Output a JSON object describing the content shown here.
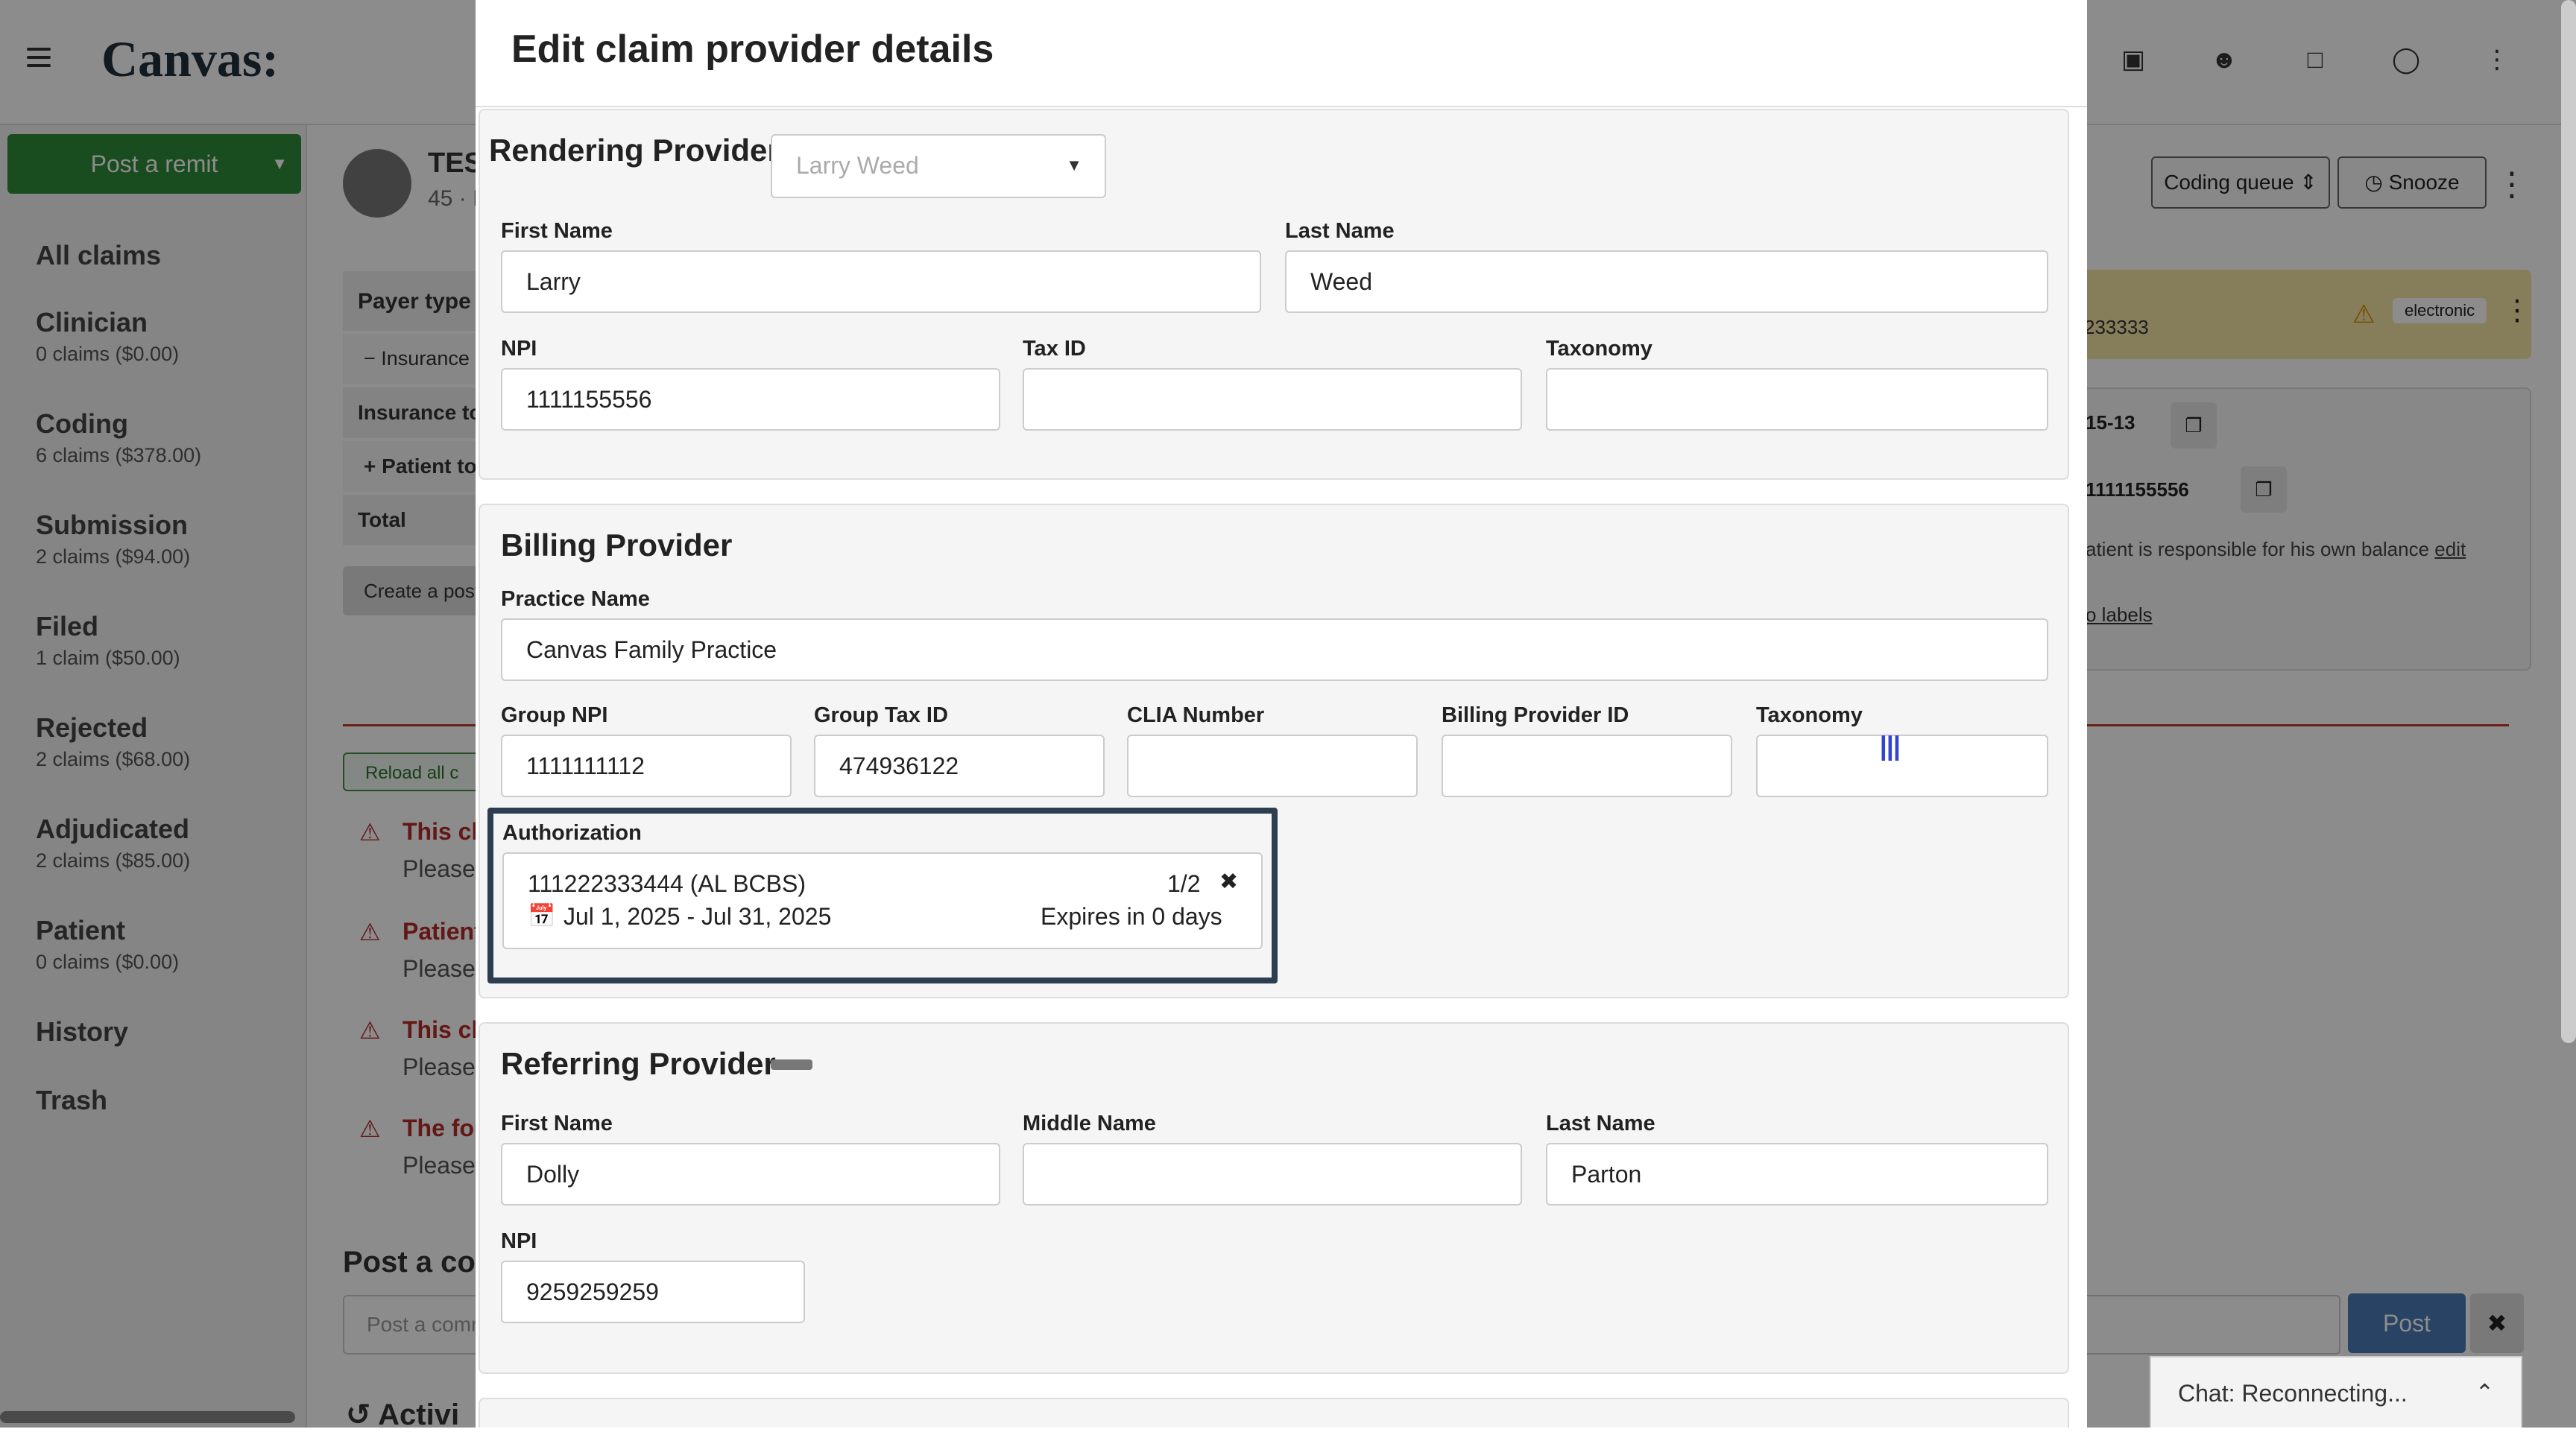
{
  "app": {
    "logo": "Canvas:"
  },
  "sidebar": {
    "post_remit": "Post a remit",
    "items": [
      {
        "label": "All claims",
        "sub": ""
      },
      {
        "label": "Clinician",
        "sub": "0 claims ($0.00)"
      },
      {
        "label": "Coding",
        "sub": "6 claims ($378.00)"
      },
      {
        "label": "Submission",
        "sub": "2 claims ($94.00)"
      },
      {
        "label": "Filed",
        "sub": "1 claim ($50.00)"
      },
      {
        "label": "Rejected",
        "sub": "2 claims ($68.00)"
      },
      {
        "label": "Adjudicated",
        "sub": "2 claims ($85.00)"
      },
      {
        "label": "Patient",
        "sub": "0 claims ($0.00)"
      },
      {
        "label": "History",
        "sub": ""
      },
      {
        "label": "Trash",
        "sub": ""
      }
    ]
  },
  "background": {
    "patient_name": "TES",
    "patient_sub": "45 · I",
    "payer_type": "Payer type",
    "insurance": "Insurance",
    "insurance_to": "Insurance to",
    "patient_to": "Patient to",
    "total": "Total",
    "create_post": "Create a post",
    "reload": "Reload all c",
    "warnings": [
      {
        "title": "This cla",
        "sub": "Please"
      },
      {
        "title": "Patient",
        "sub": "Please"
      },
      {
        "title": "This cla",
        "sub": "Please"
      },
      {
        "title": "The fol",
        "sub": "Please"
      }
    ],
    "post_a_comment": "Post a com",
    "post_placeholder": "Post a comm",
    "activity": "Activi",
    "coding_queue": "Coding queue",
    "snooze": "Snooze",
    "electronic": "electronic",
    "id_partial": "233333",
    "code_partial": "15-13",
    "npi_partial": "1111155556",
    "responsible": "atient is responsible for his own balance",
    "edit": "edit",
    "labels": "o labels",
    "post_button": "Post"
  },
  "chat": {
    "status": "Chat: Reconnecting..."
  },
  "modal": {
    "title": "Edit claim provider details",
    "rendering": {
      "title": "Rendering Provider",
      "select_value": "Larry Weed",
      "first_name_label": "First Name",
      "first_name": "Larry",
      "last_name_label": "Last Name",
      "last_name": "Weed",
      "npi_label": "NPI",
      "npi": "1111155556",
      "tax_id_label": "Tax ID",
      "tax_id": "",
      "taxonomy_label": "Taxonomy",
      "taxonomy": ""
    },
    "billing": {
      "title": "Billing Provider",
      "practice_name_label": "Practice Name",
      "practice_name": "Canvas Family Practice",
      "group_npi_label": "Group NPI",
      "group_npi": "1111111112",
      "group_tax_id_label": "Group Tax ID",
      "group_tax_id": "474936122",
      "clia_label": "CLIA Number",
      "clia": "",
      "billing_provider_id_label": "Billing Provider ID",
      "billing_provider_id": "",
      "taxonomy_label": "Taxonomy",
      "taxonomy": ""
    },
    "authorization": {
      "label": "Authorization",
      "number": "111222333444 (AL BCBS)",
      "count": "1/2",
      "date_range": "Jul 1, 2025 - Jul 31, 2025",
      "expires": "Expires in 0 days"
    },
    "referring": {
      "title": "Referring Provider",
      "first_name_label": "First Name",
      "first_name": "Dolly",
      "middle_name_label": "Middle Name",
      "middle_name": "",
      "last_name_label": "Last Name",
      "last_name": "Parton",
      "npi_label": "NPI",
      "npi": "9259259259"
    }
  }
}
